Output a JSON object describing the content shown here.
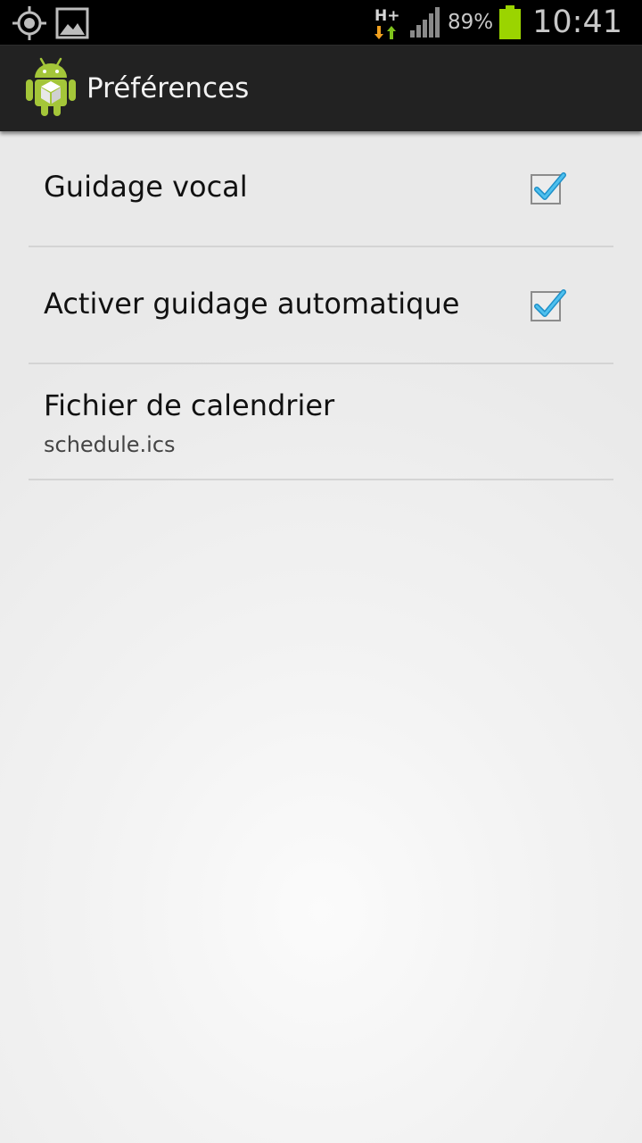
{
  "status_bar": {
    "left_icons": [
      "gps-icon",
      "image-notification-icon"
    ],
    "network_type": "H+",
    "signal_icon": "signal-icon",
    "battery_percent": "89%",
    "battery_color": "#9bd400",
    "time": "10:41"
  },
  "action_bar": {
    "icon": "android-app-icon",
    "title": "Préférences"
  },
  "preferences": [
    {
      "title": "Guidage vocal",
      "checked": true
    },
    {
      "title": "Activer guidage automatique",
      "checked": true
    },
    {
      "title": "Fichier de calendrier",
      "summary": "schedule.ics"
    }
  ],
  "colors": {
    "checkmark": "#2fa9e0",
    "action_bar_bg": "#222222",
    "status_bar_bg": "#000000",
    "android_green": "#a4c639"
  }
}
